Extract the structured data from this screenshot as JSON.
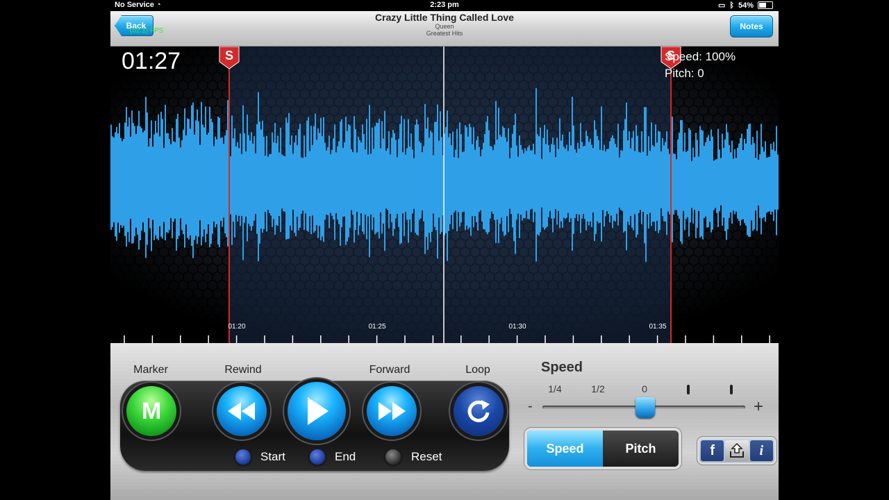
{
  "status": {
    "carrier": "No Service",
    "time": "2:23 pm",
    "battery": "54%",
    "battery_level": 0.54
  },
  "nav": {
    "back_label": "Back",
    "fps": "(62.1) FPS",
    "song_title": "Crazy Little Thing Called Love",
    "artist": "Queen",
    "album": "Greatest Hits",
    "notes_label": "Notes"
  },
  "waveform": {
    "position": "01:27",
    "speed_readout": "Speed: 100%",
    "pitch_readout": "Pitch: 0",
    "marker_label": "S",
    "ticks": [
      "01:20",
      "01:25",
      "01:30",
      "01:35"
    ]
  },
  "transport": {
    "marker_label": "Marker",
    "rewind_label": "Rewind",
    "forward_label": "Forward",
    "loop_label": "Loop",
    "marker_button": "M",
    "start_label": "Start",
    "end_label": "End",
    "reset_label": "Reset"
  },
  "speed": {
    "title": "Speed",
    "labels": [
      "1/4",
      "1/2",
      "0"
    ],
    "minus": "-",
    "plus": "+",
    "tab_speed": "Speed",
    "tab_pitch": "Pitch",
    "active_tab": "Speed"
  },
  "colors": {
    "accent": "#1ab3ff",
    "wave": "#2fa0e8",
    "marker": "#d32a2a",
    "fps": "#3ddc3d"
  }
}
